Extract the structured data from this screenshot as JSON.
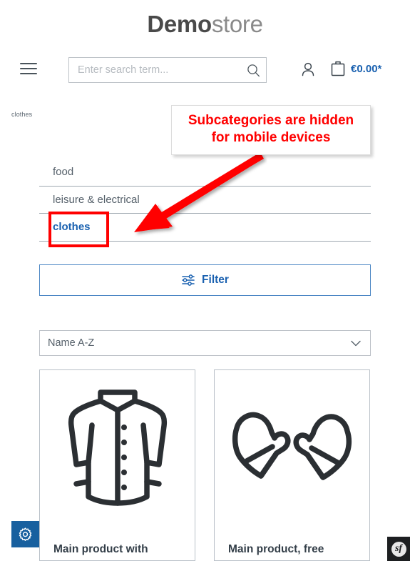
{
  "header": {
    "logo_bold": "Demo",
    "logo_light": "store",
    "menu_icon": "hamburger-menu-icon",
    "search": {
      "placeholder": "Enter search term...",
      "value": "",
      "icon": "search-icon"
    },
    "account_icon": "person-icon",
    "cart_icon": "shopping-bag-icon",
    "cart_total": "€0.00*"
  },
  "breadcrumb": {
    "current": "clothes"
  },
  "categories": [
    {
      "label": "food",
      "active": false
    },
    {
      "label": "leisure & electrical",
      "active": false
    },
    {
      "label": "clothes",
      "active": true
    }
  ],
  "filter": {
    "label": "Filter",
    "icon": "sliders-filter-icon"
  },
  "sort": {
    "selected": "Name A-Z",
    "icon": "chevron-down-icon"
  },
  "products": [
    {
      "title": "Main product with",
      "image": "jacket-icon"
    },
    {
      "title": "Main product, free",
      "image": "mittens-icon"
    }
  ],
  "settings_tab": {
    "icon": "gear-icon",
    "color": "#18609f"
  },
  "symfony_badge": {
    "icon": "symfony-logo-icon",
    "glyph": "sf"
  },
  "annotation": {
    "text_line_1": "Subcategories are hidden",
    "text_line_2": "for mobile devices",
    "color": "#ff0000"
  },
  "colors": {
    "accent_blue": "#1a61b0",
    "text_gray": "#55606a",
    "annotation_red": "#ff0000",
    "border_gray": "#bcc1c7"
  }
}
